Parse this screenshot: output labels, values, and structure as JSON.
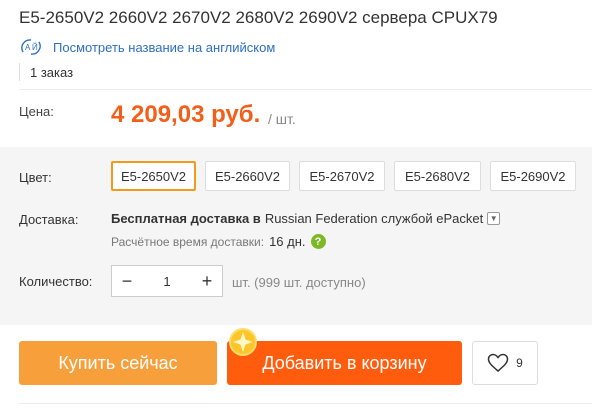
{
  "product": {
    "title": "E5-2650V2 2660V2 2670V2 2680V2 2690V2 сервера CPUX79",
    "translate_link": "Посмотреть название на английском",
    "orders": "1 заказ"
  },
  "price": {
    "label": "Цена:",
    "value": "4 209,03 руб.",
    "unit": "/ шт."
  },
  "color": {
    "label": "Цвет:",
    "options": [
      "E5-2650V2",
      "E5-2660V2",
      "E5-2670V2",
      "E5-2680V2",
      "E5-2690V2"
    ],
    "selected": "E5-2650V2"
  },
  "delivery": {
    "label": "Доставка:",
    "free_text": "Бесплатная доставка в",
    "destination": "Russian Federation службой ePacket",
    "eta_label": "Расчётное время доставки:",
    "eta_value": "16 дн."
  },
  "quantity": {
    "label": "Количество:",
    "minus": "−",
    "value": "1",
    "plus": "+",
    "available": "шт. (999 шт. доступно)"
  },
  "actions": {
    "buy_now": "Купить сейчас",
    "add_to_cart": "Добавить в корзину",
    "wishlist_count": "9"
  },
  "colors": {
    "accent_orange": "#f45e18",
    "buy_button": "#f79f3a",
    "cart_button": "#ff5c0e",
    "selected_border": "#f29a1d",
    "link_blue": "#2d6fc5"
  }
}
